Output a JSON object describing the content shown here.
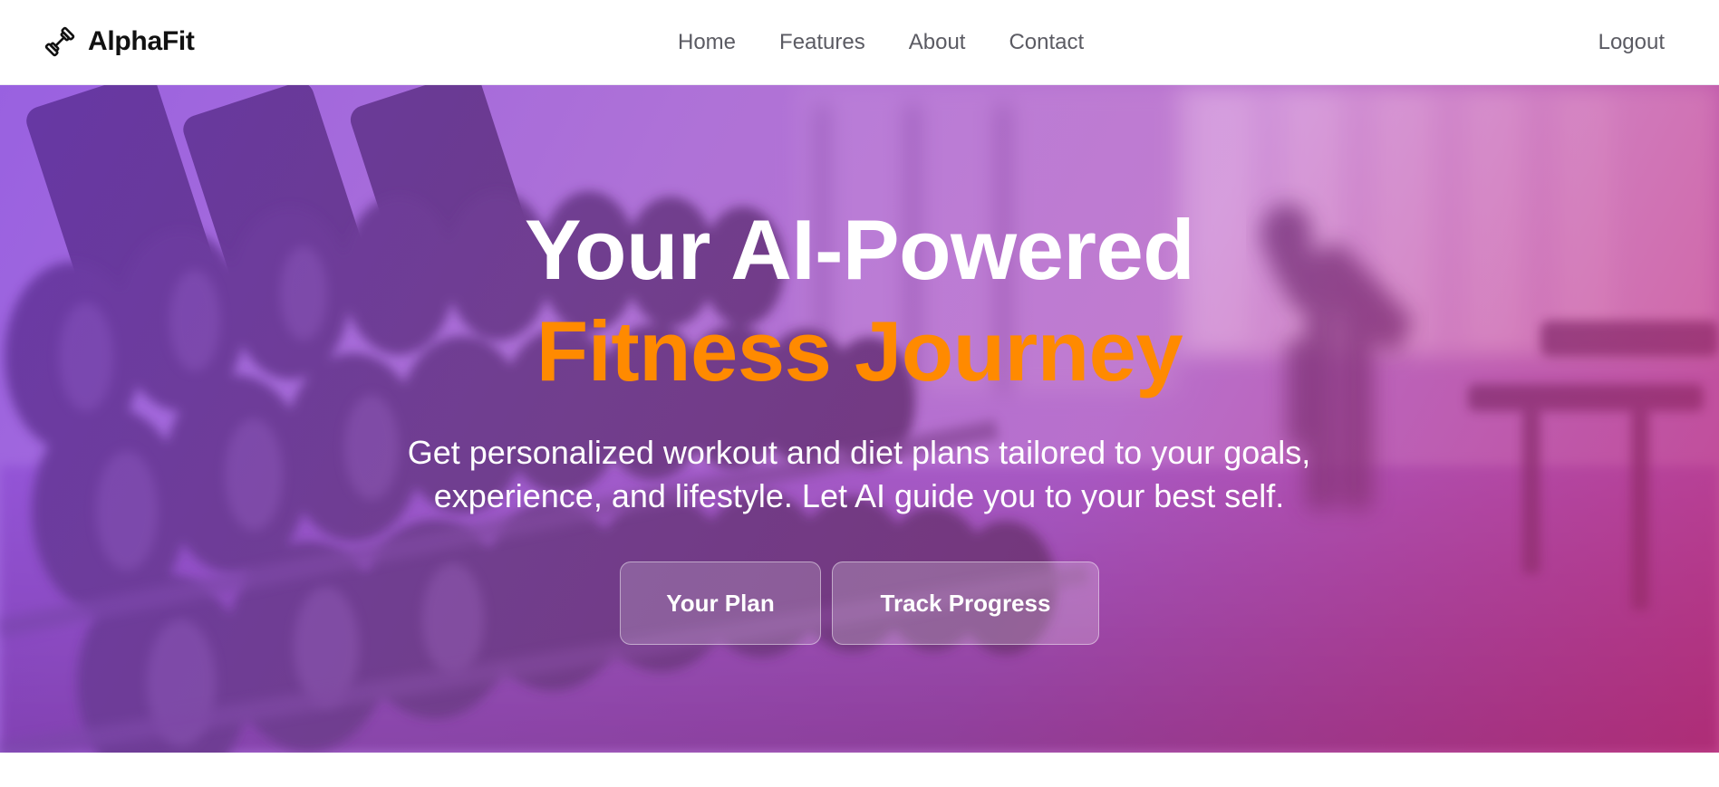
{
  "brand": {
    "name": "AlphaFit",
    "icon": "dumbbell-icon"
  },
  "nav": {
    "links": [
      {
        "label": "Home"
      },
      {
        "label": "Features"
      },
      {
        "label": "About"
      },
      {
        "label": "Contact"
      }
    ],
    "logout_label": "Logout"
  },
  "hero": {
    "title_line1": "Your AI-Powered",
    "title_line2": "Fitness Journey",
    "subtitle_line1": "Get personalized workout and diet plans tailored to your goals,",
    "subtitle_line2": "experience, and lifestyle. Let AI guide you to your best self.",
    "primary_button": "Your Plan",
    "secondary_button": "Track Progress",
    "background_image": "gym-dumbbell-rack-photo"
  },
  "colors": {
    "accent_orange": "#ff8a00",
    "gradient_start": "#8a4fe6",
    "gradient_end": "#c4256b",
    "nav_text": "#5b5b63",
    "brand_text": "#111111"
  }
}
